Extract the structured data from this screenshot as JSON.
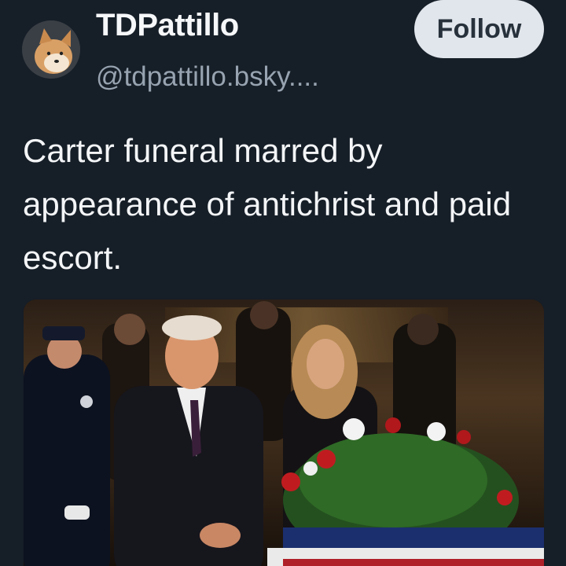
{
  "author": {
    "display_name": "TDPattillo",
    "handle": "@tdpattillo.bsky....",
    "avatar_icon": "shiba-dog-avatar"
  },
  "actions": {
    "follow_label": "Follow"
  },
  "post": {
    "text": "Carter funeral marred by appearance of antichrist and paid escort."
  },
  "colors": {
    "background": "#161e27",
    "follow_button_bg": "#e1e6ec",
    "handle_text": "#97a3b0"
  }
}
